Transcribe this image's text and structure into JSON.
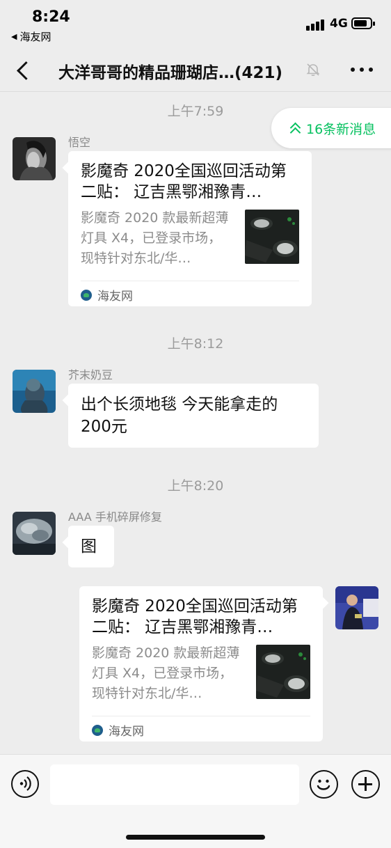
{
  "status_bar": {
    "time": "8:24",
    "back_app": "海友网",
    "network": "4G"
  },
  "nav": {
    "title": "大洋哥哥的精品珊瑚店…",
    "member_count": "(421)",
    "icons": [
      "back-chevron-icon",
      "mute-bell-icon",
      "more-dots-icon"
    ]
  },
  "new_messages": {
    "label": "16条新消息",
    "color": "#07c160"
  },
  "messages": [
    {
      "timestamp": "上午7:59",
      "sender": "悟空",
      "type": "link-card",
      "side": "left",
      "title": "影魔奇 2020全国巡回活动第二贴： 辽吉黑鄂湘豫青…",
      "description": "影魔奇 2020 款最新超薄灯具 X4，已登录市场，现特针对东北/华…",
      "source": "海友网"
    },
    {
      "timestamp": "上午8:12",
      "sender": "芥末奶豆",
      "type": "text",
      "side": "left",
      "text": "出个长须地毯  今天能拿走的200元"
    },
    {
      "timestamp": "上午8:20",
      "sender": "AAA 手机碎屏修复",
      "type": "text",
      "side": "left",
      "text": "图"
    },
    {
      "sender": "",
      "type": "link-card",
      "side": "right",
      "title": "影魔奇 2020全国巡回活动第二贴： 辽吉黑鄂湘豫青…",
      "description": "影魔奇 2020 款最新超薄灯具 X4，已登录市场，现特针对东北/华…",
      "source": "海友网"
    }
  ],
  "input_bar": {
    "input_value": "",
    "icons": [
      "voice-icon",
      "emoji-icon",
      "plus-icon"
    ]
  },
  "colors": {
    "background": "#ededed",
    "bubble": "#ffffff",
    "accent": "#07c160"
  }
}
